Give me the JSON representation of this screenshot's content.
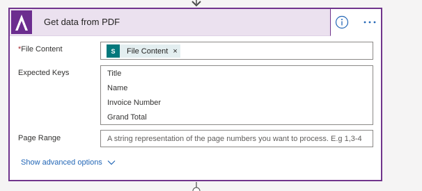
{
  "card": {
    "title": "Get data from PDF",
    "logo_icon": "astera-logo-icon",
    "info_icon": "info-icon",
    "more_icon": "more-options-icon",
    "accent_color": "#70348c"
  },
  "fields": {
    "file_content": {
      "label": "File Content",
      "required_marker": "*",
      "token_label": "File Content",
      "token_icon_text": "S",
      "token_remove": "×"
    },
    "expected_keys": {
      "label": "Expected Keys",
      "keys": [
        "Title",
        "Name",
        "Invoice Number",
        "Grand Total"
      ]
    },
    "page_range": {
      "label": "Page Range",
      "placeholder": "A string representation of the page numbers you want to process. E.g 1,3-4"
    }
  },
  "advanced": {
    "label": "Show advanced options"
  }
}
